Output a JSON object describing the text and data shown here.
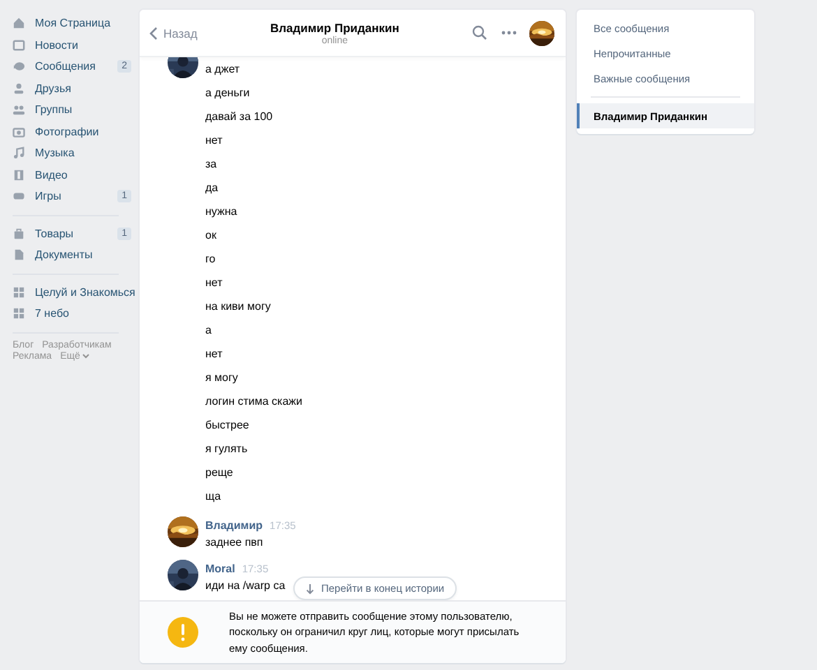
{
  "sidebar": {
    "groups": [
      [
        {
          "label": "Моя Страница"
        },
        {
          "label": "Новости"
        },
        {
          "label": "Сообщения",
          "badge": "2"
        },
        {
          "label": "Друзья"
        },
        {
          "label": "Группы"
        },
        {
          "label": "Фотографии"
        },
        {
          "label": "Музыка"
        },
        {
          "label": "Видео"
        },
        {
          "label": "Игры",
          "badge": "1"
        }
      ],
      [
        {
          "label": "Товары",
          "badge": "1"
        },
        {
          "label": "Документы"
        }
      ],
      [
        {
          "label": "Целуй и Знакомься"
        },
        {
          "label": "7 небо"
        }
      ]
    ],
    "footer": [
      {
        "label": "Блог"
      },
      {
        "label": "Разработчикам"
      },
      {
        "label": "Реклама"
      },
      {
        "label": "Ещё",
        "dropdown": true
      }
    ]
  },
  "chat": {
    "back": "Назад",
    "title": "Владимир Приданкин",
    "status": "online",
    "messages": [
      {
        "lines": [
          "а джет",
          "а деньги",
          "давай за 100",
          "нет",
          "за",
          "да",
          "нужна",
          "ок",
          "го",
          "нет",
          "на киви могу",
          "а",
          "нет",
          "я могу",
          "логин стима скажи",
          "быстрее",
          "я гулять",
          "реще",
          "ща"
        ]
      },
      {
        "author": "Владимир",
        "time": "17:35",
        "lines": [
          "заднее пвп"
        ]
      },
      {
        "author": "Moral",
        "time": "17:35",
        "lines": [
          "иди на /warp са"
        ]
      }
    ],
    "jump_button": "Перейти в конец истории",
    "notice": "Вы не можете отправить сообщение этому пользователю, поскольку он ограничил круг лиц, которые могут присылать ему сообщения."
  },
  "filters": [
    {
      "label": "Все сообщения",
      "selected": false
    },
    {
      "label": "Непрочитанные",
      "selected": false
    },
    {
      "label": "Важные сообщения",
      "selected": false
    },
    {
      "label": "Владимир Приданкин",
      "selected": true,
      "kind": "conversation"
    }
  ]
}
